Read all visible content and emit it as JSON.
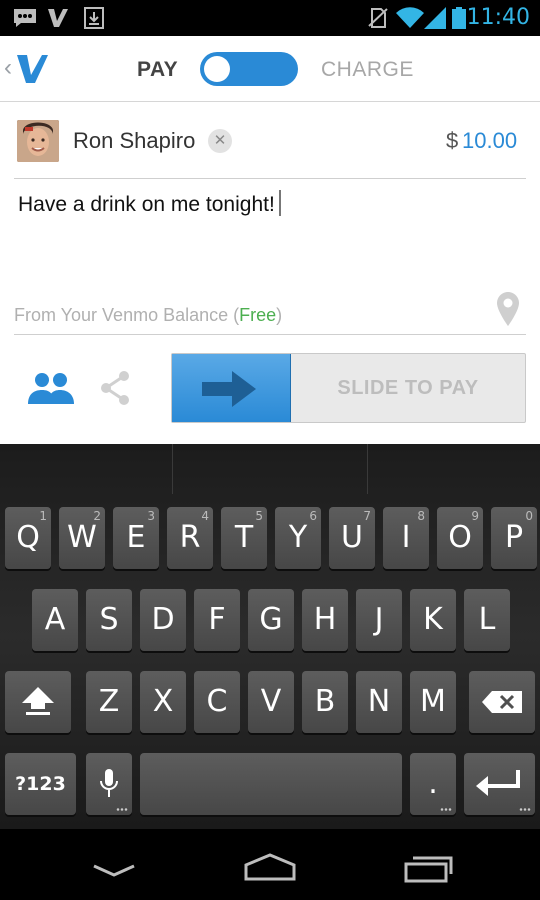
{
  "status_bar": {
    "time": "11:40",
    "icons": [
      "talk-icon",
      "venmo-notification-icon",
      "download-icon",
      "no-sim-icon",
      "wifi-icon",
      "signal-icon",
      "battery-icon"
    ]
  },
  "header": {
    "logo": "venmo-logo",
    "pay_label": "PAY",
    "charge_label": "CHARGE",
    "mode": "pay"
  },
  "payment": {
    "recipient_name": "Ron Shapiro",
    "currency_symbol": "$",
    "amount": "10.00",
    "note": "Have a drink on me tonight!",
    "funding_prefix": "From Your Venmo Balance (",
    "funding_free": "Free",
    "funding_suffix": ")",
    "slide_label": "SLIDE TO PAY"
  },
  "keyboard": {
    "row1": [
      {
        "label": "Q",
        "hint": "1"
      },
      {
        "label": "W",
        "hint": "2"
      },
      {
        "label": "E",
        "hint": "3"
      },
      {
        "label": "R",
        "hint": "4"
      },
      {
        "label": "T",
        "hint": "5"
      },
      {
        "label": "Y",
        "hint": "6"
      },
      {
        "label": "U",
        "hint": "7"
      },
      {
        "label": "I",
        "hint": "8"
      },
      {
        "label": "O",
        "hint": "9"
      },
      {
        "label": "P",
        "hint": "0"
      }
    ],
    "row2": [
      "A",
      "S",
      "D",
      "F",
      "G",
      "H",
      "J",
      "K",
      "L"
    ],
    "row3": [
      "Z",
      "X",
      "C",
      "V",
      "B",
      "N",
      "M"
    ],
    "symbols_label": "?123",
    "period_label": "."
  },
  "colors": {
    "accent": "#2a8ad6",
    "status_time": "#33b5e5",
    "free": "#4caf50"
  }
}
